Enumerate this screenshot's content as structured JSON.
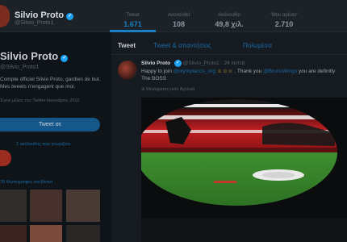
{
  "header": {
    "name": "Silvio Proto",
    "handle": "@Silvio_Proto1",
    "stats": [
      {
        "label": "Tweet",
        "value": "1.671"
      },
      {
        "label": "Ακολουθεί",
        "value": "108"
      },
      {
        "label": "Ακόλουθοι",
        "value": "49,8 χιλ."
      },
      {
        "label": "\"Μου αρέσει\"",
        "value": "2.710"
      }
    ]
  },
  "profile": {
    "name": "Silvio Proto",
    "handle": "@Silvio_Proto1",
    "bio": "Compte officiel Silvio Proto, gardien de but. Mes tweets n'engagent que moi.",
    "joined": "Έγινε μέλος του Twitter Ιανουάριος 2012",
    "tweet_button": "Tweet σε",
    "followed_by": "1 ακόλουθος που γνωρίζετε",
    "media_title": "78 Φωτογραφίες και βίντεο"
  },
  "timeline": {
    "tabs": [
      "Tweet",
      "Tweet & απαντήσεις",
      "Πολυμέσα"
    ],
    "tweet": {
      "author": "Silvio Proto",
      "handle": "@Silvio_Proto1",
      "time": "24 λεπτά",
      "text_start": "Happy to join ",
      "mention1": "@olympiacos_org",
      "emojis": " ☺☺☺ ",
      "text_mid": ". Thank you ",
      "mention2": "@BrunoWings",
      "text_end": " you are definitly The BOSS",
      "translate": "Μετάφραση από Αγγλικά"
    }
  },
  "colors": {
    "accent": "#1b7fc4",
    "background": "#0f1419"
  }
}
